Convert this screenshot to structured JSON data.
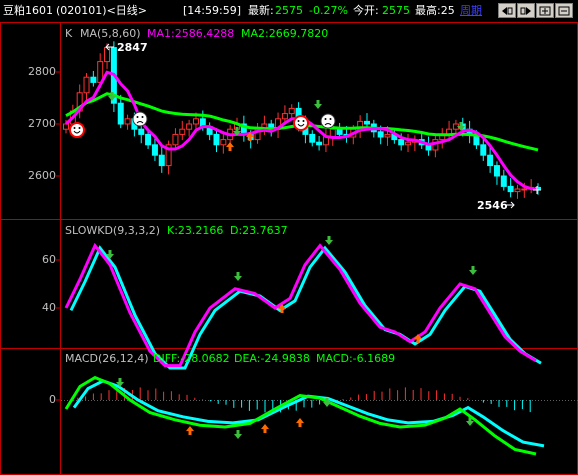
{
  "header": {
    "instrument": "豆粕1601",
    "code_period": "(020101)<日线>",
    "time": "[14:59:59]",
    "latest_label": "最新:",
    "latest_value": "2575",
    "change_pct": "-0.27%",
    "open_label": "今开:",
    "open_value": "2575",
    "high_label": "最高:25",
    "period_link": "周期",
    "nav_buttons": [
      "prev-icon",
      "next-icon",
      "zoom-in-icon",
      "zoom-out-icon"
    ]
  },
  "main_panel": {
    "k_label": "K",
    "ma_label": "MA(5,8,60)",
    "ma1_text": "MA1:2586.4288",
    "ma2_text": "MA2:2669.7820",
    "high_annotation": "2847",
    "low_annotation": "2546",
    "y_ticks": [
      "2800",
      "2700",
      "2600"
    ]
  },
  "kd_panel": {
    "title": "SLOWKD(9,3,3,2)",
    "k_text": "K:23.2166",
    "d_text": "D:23.7637",
    "y_ticks": [
      "60",
      "40"
    ]
  },
  "macd_panel": {
    "title": "MACD(26,12,4)",
    "diff_text": "DIFF:-28.0682",
    "dea_text": "DEA:-24.9838",
    "macd_text": "MACD:-6.1689",
    "y_ticks": [
      "0"
    ]
  },
  "colors": {
    "up": "#ff3232",
    "down": "#00ffff",
    "ma1": "#ff00ff",
    "ma2": "#00ff00",
    "text_green": "#00ff00",
    "text_red": "#ff3232",
    "axis": "#c00000",
    "highlight": "#ffff00",
    "signal_green": "#3cbf3c",
    "signal_orange": "#ff6a00"
  }
}
